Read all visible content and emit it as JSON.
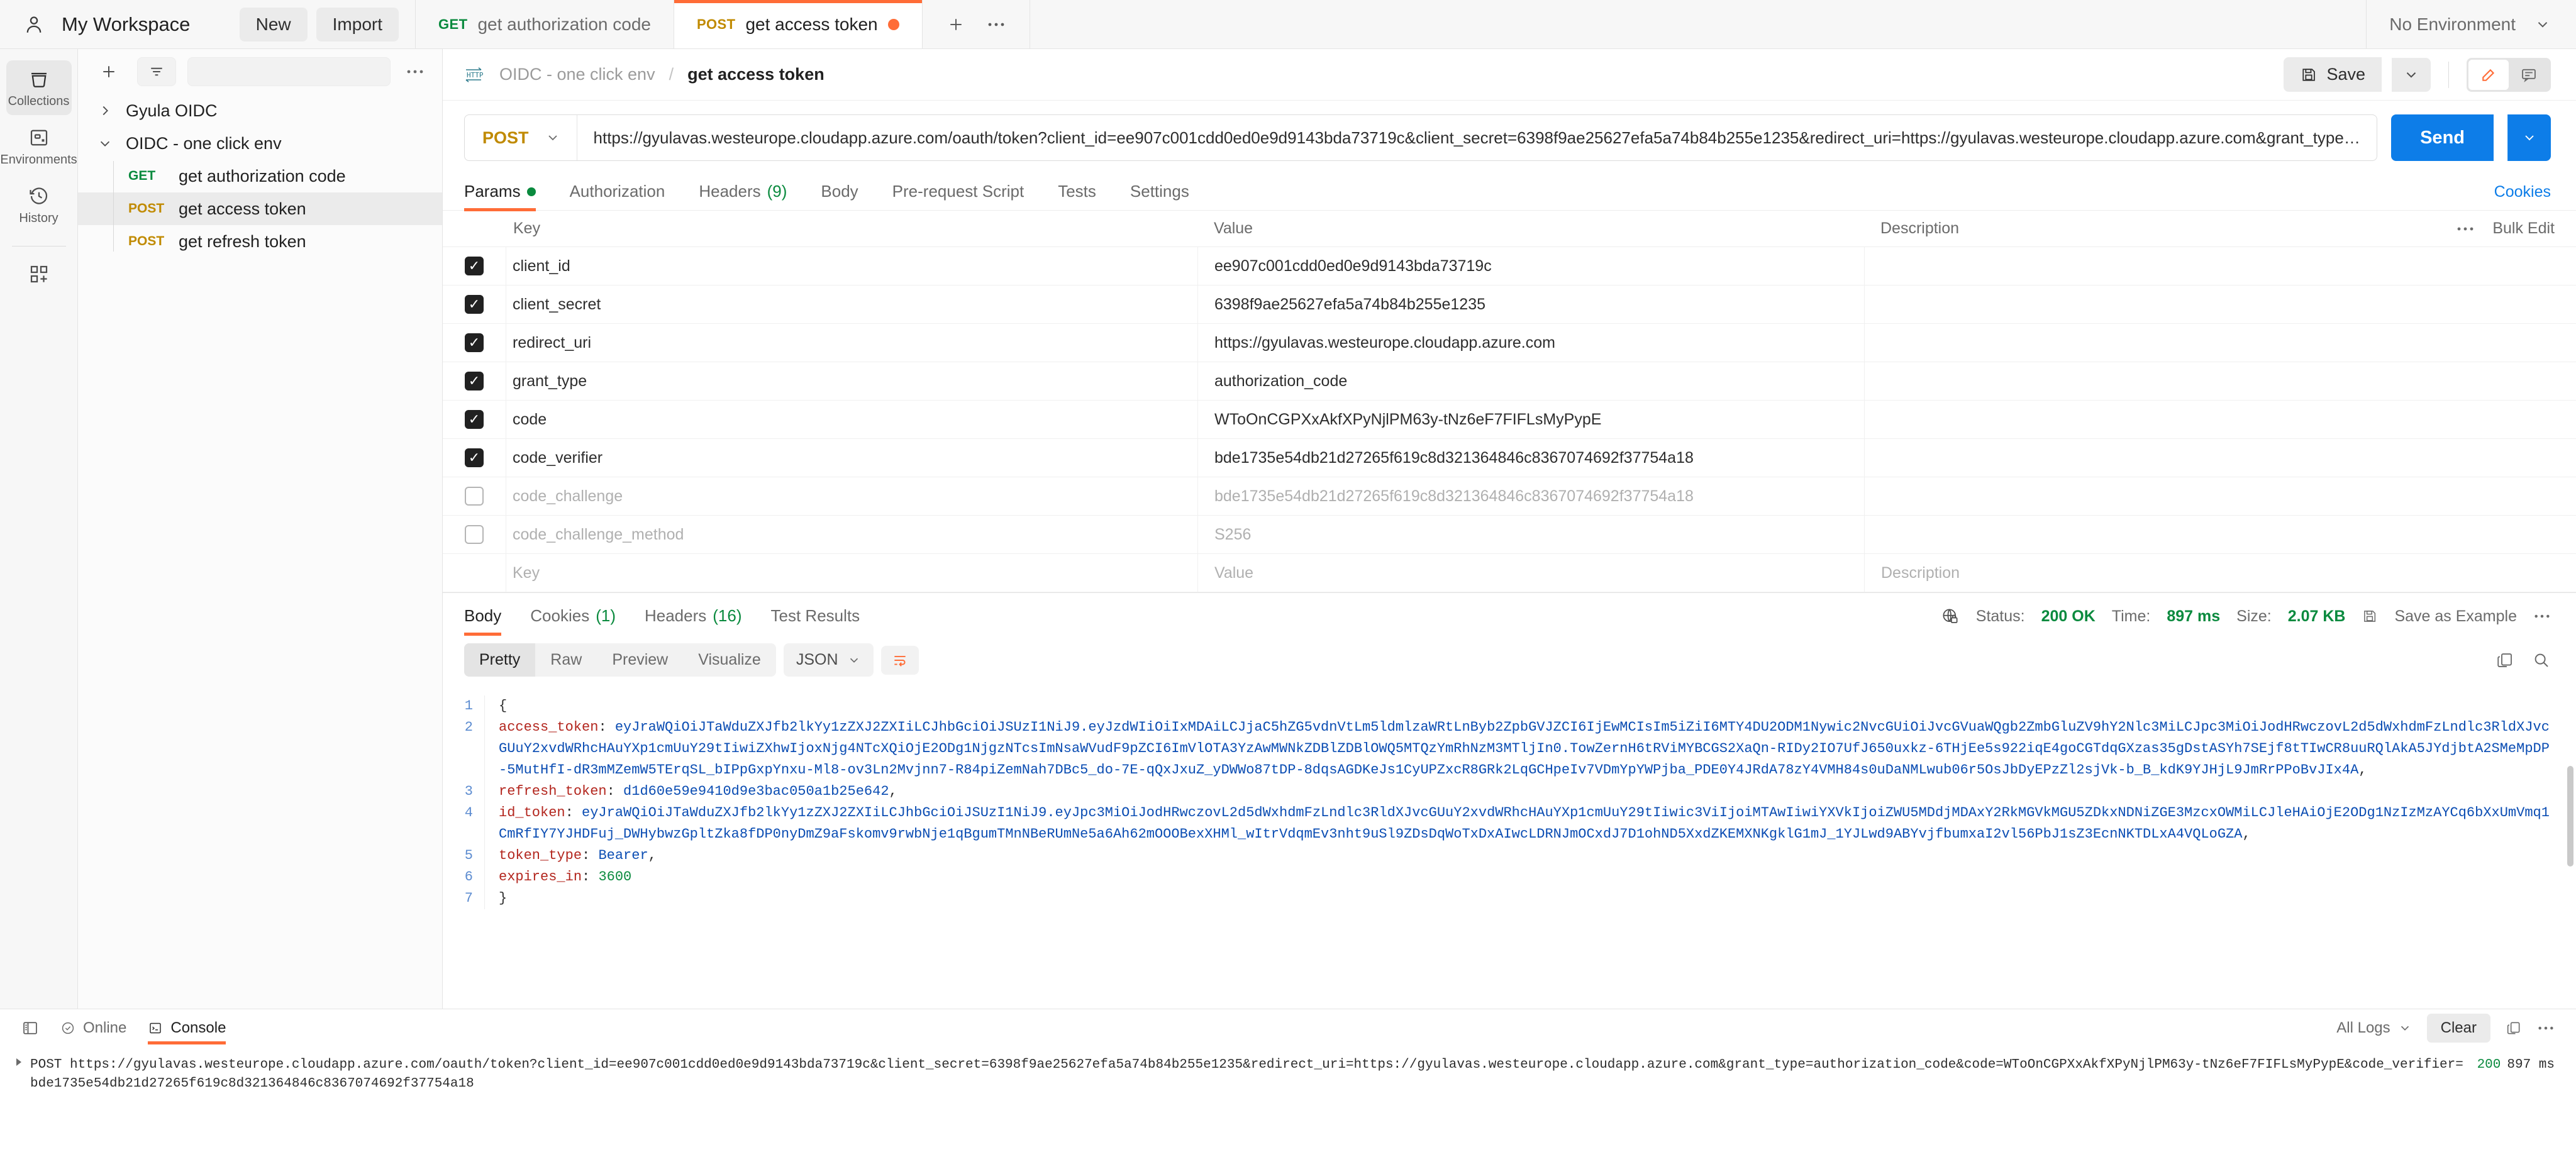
{
  "topbar": {
    "workspace": "My Workspace",
    "new_label": "New",
    "import_label": "Import",
    "environment": "No Environment",
    "tabs": [
      {
        "method": "GET",
        "label": "get authorization code",
        "dirty": false,
        "active": false
      },
      {
        "method": "POST",
        "label": "get access token",
        "dirty": true,
        "active": true
      }
    ],
    "add_tab_icon": "plus-icon",
    "tab_more_icon": "ellipsis-icon"
  },
  "rail": {
    "items": [
      {
        "label": "Collections",
        "icon": "collections-icon",
        "active": true
      },
      {
        "label": "Environments",
        "icon": "environments-icon",
        "active": false
      },
      {
        "label": "History",
        "icon": "history-icon",
        "active": false
      }
    ],
    "add_icon": "grid-plus-icon"
  },
  "sidebar": {
    "new_icon": "plus-icon",
    "filter_icon": "filter-icon",
    "more_icon": "ellipsis-icon",
    "collections": [
      {
        "name": "Gyula OIDC",
        "expanded": false,
        "requests": []
      },
      {
        "name": "OIDC - one click env",
        "expanded": true,
        "requests": [
          {
            "method": "GET",
            "name": "get authorization code",
            "selected": false
          },
          {
            "method": "POST",
            "name": "get access token",
            "selected": true
          },
          {
            "method": "POST",
            "name": "get refresh token",
            "selected": false
          }
        ]
      }
    ]
  },
  "request": {
    "breadcrumb": {
      "icon": "http-icon",
      "parent": "OIDC - one click env",
      "separator": "/",
      "current": "get access token"
    },
    "save_label": "Save",
    "save_icon": "floppy-icon",
    "save_caret_icon": "chevron-down-icon",
    "edit_icon": "pencil-icon",
    "comment_icon": "comment-icon",
    "method": "POST",
    "method_caret_icon": "chevron-down-icon",
    "url": "https://gyulavas.westeurope.cloudapp.azure.com/oauth/token?client_id=ee907c001cdd0ed0e9d9143bda73719c&client_secret=6398f9ae25627efa5a74b84b255e1235&redirect_uri=https://gyulavas.westeurope.cloudapp.azure.com&grant_type=authorization_code&code=W…",
    "send_label": "Send",
    "send_caret_icon": "chevron-down-icon",
    "tabs": [
      {
        "label": "Params",
        "badge": "",
        "dot": true,
        "active": true
      },
      {
        "label": "Authorization",
        "badge": "",
        "dot": false,
        "active": false
      },
      {
        "label": "Headers",
        "badge": "(9)",
        "dot": false,
        "active": false
      },
      {
        "label": "Body",
        "badge": "",
        "dot": false,
        "active": false
      },
      {
        "label": "Pre-request Script",
        "badge": "",
        "dot": false,
        "active": false
      },
      {
        "label": "Tests",
        "badge": "",
        "dot": false,
        "active": false
      },
      {
        "label": "Settings",
        "badge": "",
        "dot": false,
        "active": false
      }
    ],
    "cookies_link": "Cookies",
    "params_table": {
      "headers": {
        "key": "Key",
        "value": "Value",
        "description": "Description"
      },
      "more_icon": "ellipsis-icon",
      "bulk_edit": "Bulk Edit",
      "rows": [
        {
          "checked": true,
          "key": "client_id",
          "value": "ee907c001cdd0ed0e9d9143bda73719c",
          "description": "",
          "placeholder": false
        },
        {
          "checked": true,
          "key": "client_secret",
          "value": "6398f9ae25627efa5a74b84b255e1235",
          "description": "",
          "placeholder": false
        },
        {
          "checked": true,
          "key": "redirect_uri",
          "value": "https://gyulavas.westeurope.cloudapp.azure.com",
          "description": "",
          "placeholder": false
        },
        {
          "checked": true,
          "key": "grant_type",
          "value": "authorization_code",
          "description": "",
          "placeholder": false
        },
        {
          "checked": true,
          "key": "code",
          "value": "WToOnCGPXxAkfXPyNjlPM63y-tNz6eF7FIFLsMyPypE",
          "description": "",
          "placeholder": false
        },
        {
          "checked": true,
          "key": "code_verifier",
          "value": "bde1735e54db21d27265f619c8d321364846c8367074692f37754a18",
          "description": "",
          "placeholder": false
        },
        {
          "checked": false,
          "key": "code_challenge",
          "value": "bde1735e54db21d27265f619c8d321364846c8367074692f37754a18",
          "description": "",
          "placeholder": true
        },
        {
          "checked": false,
          "key": "code_challenge_method",
          "value": "S256",
          "description": "",
          "placeholder": true
        },
        {
          "checked": false,
          "key": "Key",
          "value": "Value",
          "description": "Description",
          "placeholder": true
        }
      ]
    }
  },
  "response": {
    "tabs": [
      {
        "label": "Body",
        "badge": "",
        "active": true
      },
      {
        "label": "Cookies",
        "badge": "(1)",
        "active": false
      },
      {
        "label": "Headers",
        "badge": "(16)",
        "active": false
      },
      {
        "label": "Test Results",
        "badge": "",
        "active": false
      }
    ],
    "meta": {
      "lock_icon": "globe-lock-icon",
      "status_label": "Status:",
      "status_value": "200 OK",
      "time_label": "Time:",
      "time_value": "897 ms",
      "size_label": "Size:",
      "size_value": "2.07 KB",
      "save_example_label": "Save as Example",
      "save_example_icon": "floppy-icon",
      "more_icon": "ellipsis-icon"
    },
    "view_modes": [
      "Pretty",
      "Raw",
      "Preview",
      "Visualize"
    ],
    "active_view": "Pretty",
    "format": "JSON",
    "format_caret_icon": "chevron-down-icon",
    "wrap_icon": "wrap-lines-icon",
    "copy_icon": "copy-icon",
    "search_icon": "search-icon",
    "body": {
      "lines": [
        {
          "num": "1",
          "type": "brace",
          "text": "{"
        },
        {
          "num": "2",
          "type": "kv-str",
          "key": "access_token",
          "value": "eyJraWQiOiJTaWduZXJfb2lkYy1zZXJ2ZXIiLCJhbGciOiJSUzI1NiJ9.eyJzdWIiOiIxMDAiLCJjaC5hZG5vdnVtLm5ldmlzaWRtLnByb2ZpbGVJZCI6IjEwMCIsIm5iZiI6MTY4DU2ODM1Nywic2NvcGUiOiJvcGVuaWQgb2ZmbGluZV9hY2Nlc3MiLCJpc3MiOiJodHRwczovL2d5dWxhdmFzLndlc3RldXJvcGUuY2xvdWRhcHAuYXp1cmUuY29tIiwiZXhwIjoxNjg4NTcXQiOjE2ODg1NjgzNTcsImNsaWVudF9pZCI6ImVlOTA3YzAwMWNkZDBlZDBlOWQ5MTQzYmRhNzM3MTljIn0.TowZernH6tRViMYBCGS2XaQn-RIDy2IO7UfJ650uxkz-6THjEe5s922iqE4goCGTdqGXzas35gDstASYh7SEjf8tTIwCR8uuRQlAkA5JYdjbtA2SMeMpDP-5MutHfI-dR3mMZemW5TErqSL_bIPpGxpYnxu-Ml8-ov3Ln2Mvjnn7-R84piZemNah7DBc5_do-7E-qQxJxuZ_yDWWo87tDP-8dqsAGDKeJs1CyUPZxcR8GRk2LqGCHpeIv7VDmYpYWPjba_PDE0Y4JRdA78zY4VMH84s0uDaNMLwub06r5OsJbDyEPzZl2sjVk-b_B_kdK9YJHjL9JmRrPPoBvJIx4A"
        },
        {
          "num": "3",
          "type": "kv-str",
          "key": "refresh_token",
          "value": "d1d60e59e9410d9e3bac050a1b25e642"
        },
        {
          "num": "4",
          "type": "kv-str",
          "key": "id_token",
          "value": "eyJraWQiOiJTaWduZXJfb2lkYy1zZXJ2ZXIiLCJhbGciOiJSUzI1NiJ9.eyJpc3MiOiJodHRwczovL2d5dWxhdmFzLndlc3RldXJvcGUuY2xvdWRhcHAuYXp1cmUuY29tIiwic3ViIjoiMTAwIiwiYXVkIjoiZWU5MDdjMDAxY2RkMGVkMGU5ZDkxNDNiZGE3MzcxOWMiLCJleHAiOjE2ODg1NzIzMzAYCq6bXxUmVmq1CmRfIY7YJHDFuj_DWHybwzGpltZka8fDP0nyDmZ9aFskomv9rwbNje1qBgumTMnNBeRUmNe5a6Ah62mOOOBexXHMl_wItrVdqmEv3nht9uSl9ZDsDqWoTxDxAIwcLDRNJmOCxdJ7D1ohND5XxdZKEMXNKgklG1mJ_1YJLwd9ABYvjfbumxaI2vl56PbJ1sZ3EcnNKTDLxA4VQLoGZA"
        },
        {
          "num": "5",
          "type": "kv-str",
          "key": "token_type",
          "value": "Bearer"
        },
        {
          "num": "6",
          "type": "kv-num",
          "key": "expires_in",
          "value": "3600"
        },
        {
          "num": "7",
          "type": "brace",
          "text": "}"
        }
      ]
    }
  },
  "console": {
    "layout_icon": "layout-icon",
    "online_label": "Online",
    "online_icon": "check-circle-icon",
    "console_label": "Console",
    "console_icon": "terminal-icon",
    "filter_label": "All Logs",
    "filter_caret_icon": "chevron-down-icon",
    "clear_label": "Clear",
    "copy_icon": "copy-icon",
    "more_icon": "ellipsis-icon",
    "entries": [
      {
        "caret_icon": "triangle-right-icon",
        "text": "POST https://gyulavas.westeurope.cloudapp.azure.com/oauth/token?client_id=ee907c001cdd0ed0e9d9143bda73719c&client_secret=6398f9ae25627efa5a74b84b255e1235&redirect_uri=https://gyulavas.westeurope.cloudapp.azure.com&grant_type=authorization_code&code=WToOnCGPXxAkfXPyNjlPM63y-tNz6eF7FIFLsMyPypE&code_verifier=bde1735e54db21d27265f619c8d321364846c8367074692f37754a18",
        "status": "200",
        "time": "897 ms"
      }
    ]
  },
  "colors": {
    "accent": "#ff6c37",
    "send": "#0d7de8",
    "success": "#0a8a3e",
    "post": "#c08a00",
    "get": "#0a8a3e"
  }
}
